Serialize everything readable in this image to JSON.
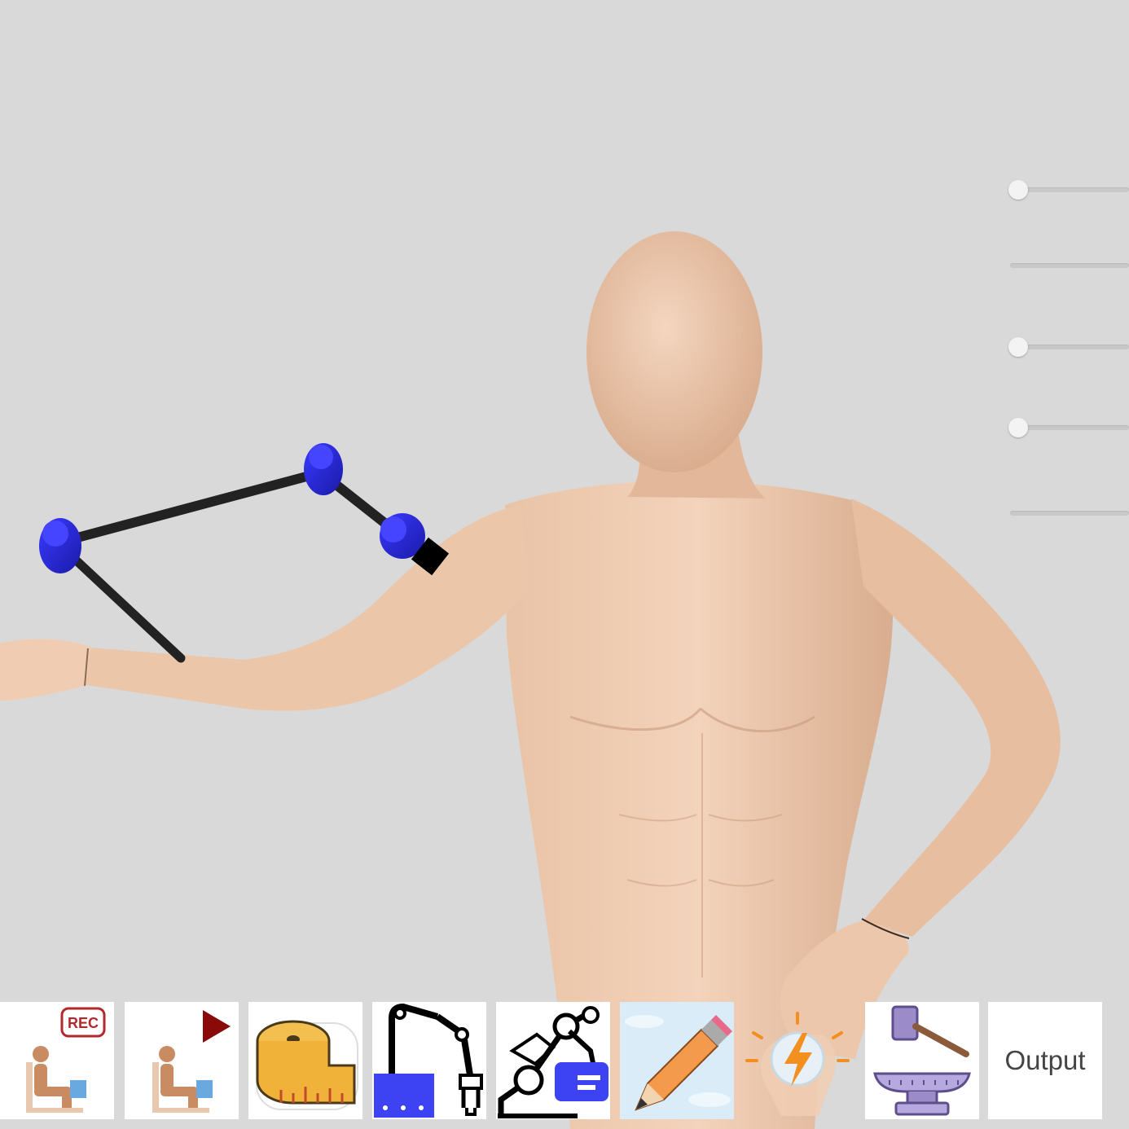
{
  "viewport": {
    "background": "#d9d9d9",
    "model": "human-mannequin",
    "exoskeleton": {
      "joint_color": "#2626e0",
      "link_color": "#222222",
      "endpoint_color": "#000000"
    }
  },
  "sliders": [
    {
      "id": "slider-1",
      "value": 0
    },
    {
      "id": "slider-2",
      "value": 0
    },
    {
      "id": "slider-3",
      "value": 0
    },
    {
      "id": "slider-4",
      "value": 0
    },
    {
      "id": "slider-5",
      "value": 0
    }
  ],
  "toolbar": {
    "items": [
      {
        "id": "record",
        "icon": "sitting-figure-record-icon",
        "badge": "REC",
        "badge_color": "#b3282d"
      },
      {
        "id": "play",
        "icon": "sitting-figure-play-icon",
        "play_color": "#8a0a0a"
      },
      {
        "id": "measure",
        "icon": "measuring-tape-icon",
        "color": "#f1b23a"
      },
      {
        "id": "robot-arm",
        "icon": "robot-arm-icon",
        "color": "#3d43f2"
      },
      {
        "id": "robot-card",
        "icon": "robot-arm-card-icon",
        "color": "#3d43f2"
      },
      {
        "id": "edit",
        "icon": "pencil-icon",
        "color": "#f39a4c"
      },
      {
        "id": "power",
        "icon": "hand-lightning-icon",
        "color": "#f28f1f"
      },
      {
        "id": "forge",
        "icon": "hammer-anvil-icon",
        "color": "#9b8bc9"
      },
      {
        "id": "output",
        "label": "Output"
      }
    ]
  }
}
